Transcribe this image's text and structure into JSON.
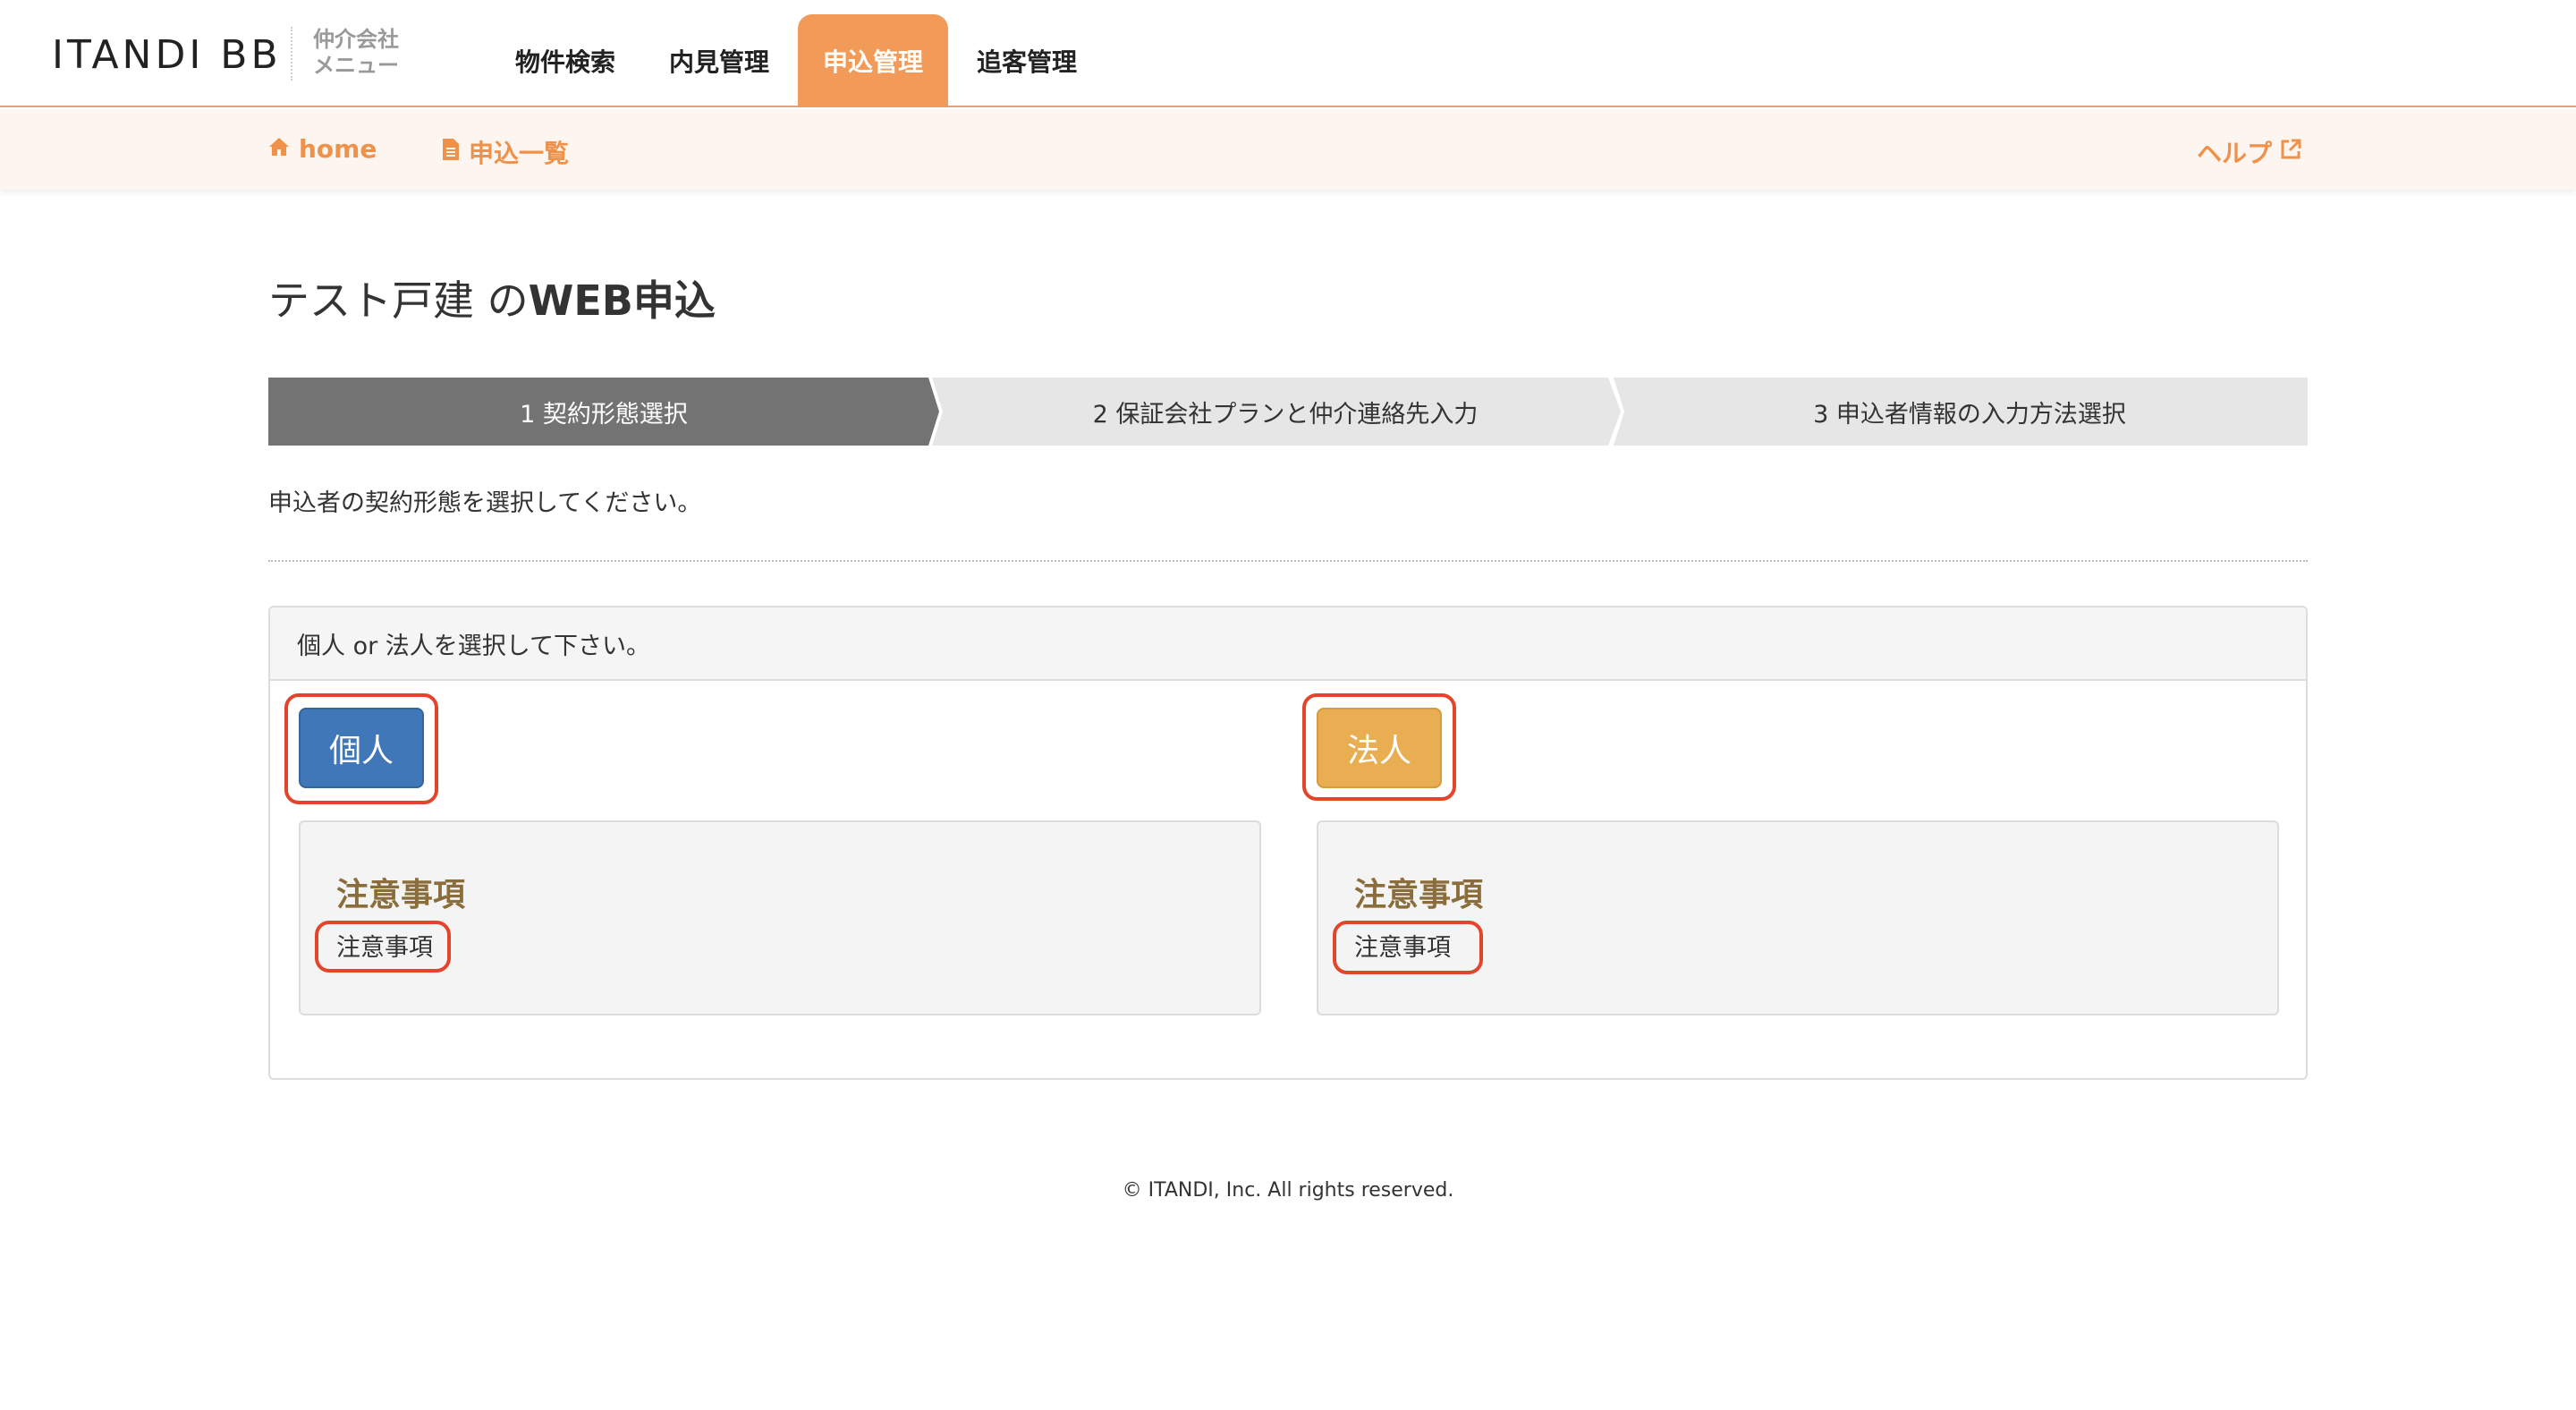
{
  "header": {
    "logo": "ITANDI BB",
    "logo_sub_line1": "仲介会社",
    "logo_sub_line2": "メニュー",
    "tabs": [
      {
        "label": "物件検索",
        "active": false
      },
      {
        "label": "内見管理",
        "active": false
      },
      {
        "label": "申込管理",
        "active": true
      },
      {
        "label": "追客管理",
        "active": false
      }
    ]
  },
  "subnav": {
    "home_icon": "home-icon",
    "home_label": "home",
    "list_icon": "document-icon",
    "list_label": "申込一覧",
    "help_label": "ヘルプ",
    "help_icon": "external-link-icon"
  },
  "page": {
    "title_prefix": "テスト戸建 の",
    "title_bold": "WEB申込"
  },
  "steps": [
    {
      "label": "1 契約形態選択",
      "active": true
    },
    {
      "label": "2 保証会社プランと仲介連絡先入力",
      "active": false
    },
    {
      "label": "3 申込者情報の入力方法選択",
      "active": false
    }
  ],
  "instruction": "申込者の契約形態を選択してください。",
  "panel": {
    "heading": "個人 or 法人を選択して下さい。",
    "options": [
      {
        "button": "個人",
        "notice_title": "注意事項",
        "notice_body": "注意事項"
      },
      {
        "button": "法人",
        "notice_title": "注意事項",
        "notice_body": "注意事項"
      }
    ]
  },
  "colors": {
    "accent": "#f29b58",
    "kojin_button": "#3f77b8",
    "houjin_button": "#e9ad52",
    "highlight": "#e2452c"
  },
  "footer": "© ITANDI, Inc. All rights reserved."
}
